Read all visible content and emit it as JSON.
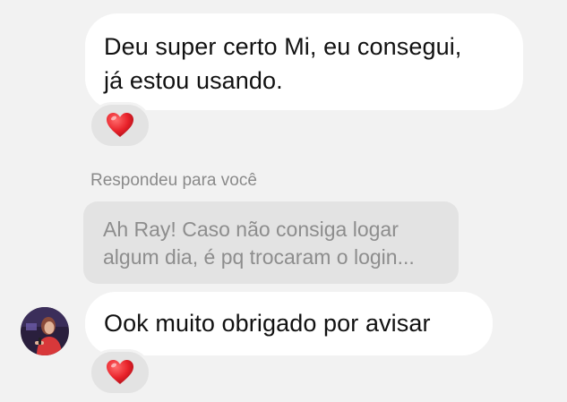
{
  "messages": [
    {
      "lines": [
        "Deu super certo Mi, eu consegui,",
        "já estou usando."
      ],
      "reaction": "red-heart"
    },
    {
      "reply_label": "Respondeu para você",
      "quoted_lines": [
        "Ah Ray! Caso não consiga logar",
        "algum dia, é pq trocaram o login..."
      ]
    },
    {
      "text": "Ook muito obrigado por avisar",
      "reaction": "red-heart"
    }
  ],
  "colors": {
    "background": "#f2f2f2",
    "bubble": "#ffffff",
    "quoted_bubble": "#e3e3e3",
    "secondary_text": "#8a8a8a",
    "heart": "#e8222a"
  },
  "icons": {
    "reaction": "heart-icon",
    "avatar": "avatar"
  }
}
